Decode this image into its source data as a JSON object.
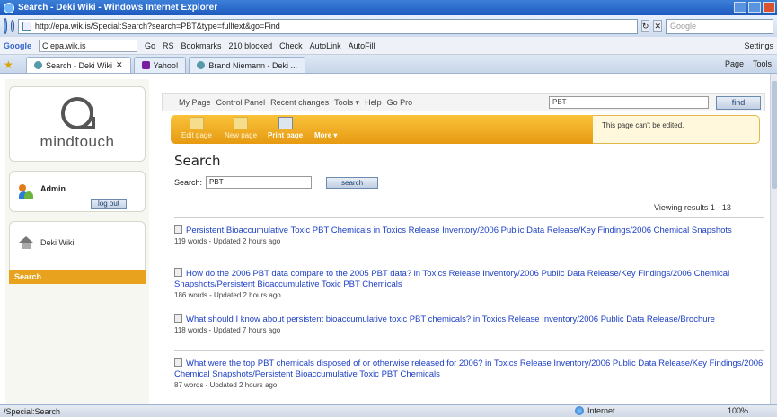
{
  "window": {
    "title": "Search - Deki Wiki - Windows Internet Explorer"
  },
  "address": {
    "url": "http://epa.wik.is/Special:Search?search=PBT&type=fulltext&go=Find",
    "search_placeholder": "Google"
  },
  "google_toolbar": {
    "logo": "Google",
    "box_text": "C epa.wik.is",
    "items": [
      "Go",
      "RS",
      "Bookmarks",
      "210 blocked",
      "Check",
      "AutoLink",
      "AutoFill"
    ],
    "settings": "Settings"
  },
  "tabs": [
    {
      "label": "Search - Deki Wiki",
      "active": true
    },
    {
      "label": "Yahoo!",
      "active": false
    },
    {
      "label": "Brand Niemann - Deki ...",
      "active": false
    }
  ],
  "ie_tools": {
    "page": "Page",
    "tools": "Tools"
  },
  "sidebar": {
    "logo_text": "mindtouch",
    "user": {
      "name": "Admin",
      "logout": "log out"
    },
    "nav_title": "Deki Wiki",
    "active_item": "Search"
  },
  "topmenu": {
    "items": [
      "My Page",
      "Control Panel",
      "Recent changes",
      "Tools ▾",
      "Help",
      "Go Pro"
    ],
    "search_value": "PBT",
    "find_label": "find"
  },
  "editbar": {
    "items": [
      {
        "label": "Edit page",
        "enabled": false
      },
      {
        "label": "New page",
        "enabled": false
      },
      {
        "label": "Print page",
        "enabled": true
      },
      {
        "label": "More ▾",
        "enabled": true
      }
    ],
    "notice": "This page can't be edited."
  },
  "page": {
    "heading": "Search",
    "search_label": "Search:",
    "search_value": "PBT",
    "search_button": "search",
    "viewing": "Viewing results 1 - 13"
  },
  "results": [
    {
      "title": "Persistent Bioaccumulative Toxic PBT Chemicals",
      "context": " in Toxics Release Inventory/2006 Public Data Release/Key Findings/2006 Chemical Snapshots",
      "meta": "119 words - Updated 2 hours ago"
    },
    {
      "title": "How do the 2006 PBT data compare to the 2005 PBT data?",
      "context": " in Toxics Release Inventory/2006 Public Data Release/Key Findings/2006 Chemical Snapshots/Persistent Bioaccumulative Toxic PBT Chemicals",
      "meta": "186 words - Updated 2 hours ago"
    },
    {
      "title": "What should I know about persistent bioaccumulative toxic PBT chemicals?",
      "context": " in Toxics Release Inventory/2006 Public Data Release/Brochure",
      "meta": "118 words - Updated 7 hours ago"
    },
    {
      "title": "What were the top PBT chemicals disposed of or otherwise released for 2006?",
      "context": " in Toxics Release Inventory/2006 Public Data Release/Key Findings/2006 Chemical Snapshots/Persistent Bioaccumulative Toxic PBT Chemicals",
      "meta": "87 words - Updated 2 hours ago"
    }
  ],
  "status": {
    "left": "/Special:Search",
    "zone": "Internet",
    "zoom": "100%"
  }
}
